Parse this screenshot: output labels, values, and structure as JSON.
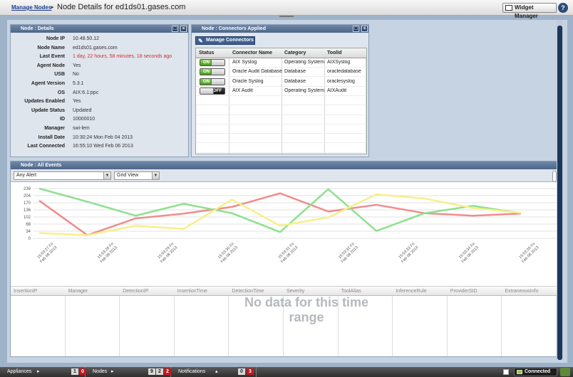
{
  "header": {
    "breadcrumb_link": "Manage Nodes",
    "title": "Node Details for ed1ds01.gases.com",
    "widget_manager_label": "Widget Manager",
    "help_label": "?"
  },
  "details_panel": {
    "title": "Node : Details",
    "rows": [
      {
        "label": "Node IP",
        "value": "10.48.50.12"
      },
      {
        "label": "Node Name",
        "value": "ed1ds01.gases.com"
      },
      {
        "label": "Last Event",
        "value": "1 day, 22 hours, 58 minutes, 18 seconds ago",
        "highlight": true
      },
      {
        "label": "Agent Node",
        "value": "Yes"
      },
      {
        "label": "USB",
        "value": "No"
      },
      {
        "label": "Agent Version",
        "value": "5.3.1"
      },
      {
        "label": "OS",
        "value": "AIX:6.1:ppc"
      },
      {
        "label": "Updates Enabled",
        "value": "Yes"
      },
      {
        "label": "Update Status",
        "value": "Updated"
      },
      {
        "label": "ID",
        "value": "10000010"
      },
      {
        "label": "Manager",
        "value": "swi-lem"
      },
      {
        "label": "Install Date",
        "value": "10:30:24 Mon Feb 04 2013"
      },
      {
        "label": "Last Connected",
        "value": "16:55:10 Wed Feb 06 2013"
      }
    ]
  },
  "connectors_panel": {
    "title": "Node : Connectors Applied",
    "manage_button": "Manage Connectors",
    "columns": [
      "Status",
      "Connector Name",
      "Category",
      "ToolId"
    ],
    "rows": [
      {
        "status": "ON",
        "name": "AIX Syslog",
        "category": "Operating System",
        "toolid": "AIXSyslog"
      },
      {
        "status": "ON",
        "name": "Oracle Audit Database",
        "category": "Database",
        "toolid": "oracledatabase"
      },
      {
        "status": "ON",
        "name": "Oracle Syslog",
        "category": "Database",
        "toolid": "oraclesyslog"
      },
      {
        "status": "OFF",
        "name": "AIX Audit",
        "category": "Operating System",
        "toolid": "AIXAudit"
      }
    ]
  },
  "events_panel": {
    "title": "Node : All Events",
    "filter_select": "Any Alert",
    "view_select": "Grid View",
    "no_data_message": "No data for this time range",
    "grid_columns": [
      "InsertionIP",
      "Manager",
      "DetectionIP",
      "InsertionTime",
      "DetectionTime",
      "Severity",
      "ToolAlias",
      "InferenceRule",
      "ProviderSID",
      "ExtraneousInfo"
    ]
  },
  "chart_data": {
    "type": "line",
    "yticks": [
      0,
      34,
      68,
      102,
      136,
      170,
      204,
      238
    ],
    "ylim": [
      0,
      238
    ],
    "categories": [
      "15:53:27 Fri Feb 08 2013",
      "15:53:28 Fri Feb 08 2013",
      "15:53:29 Fri Feb 08 2013",
      "15:53:30 Fri Feb 08 2013",
      "15:53:31 Fri Feb 08 2013",
      "15:53:32 Fri Feb 08 2013",
      "15:53:33 Fri Feb 08 2013",
      "15:53:34 Fri Feb 08 2013",
      "15:53:35 Fri Feb 08 2013"
    ],
    "series": [
      {
        "color": "#f08c8c",
        "x": [
          0,
          0.8,
          1.6,
          2.4,
          3.2,
          4.0,
          4.8,
          5.6,
          6.4,
          7.2,
          8.0
        ],
        "values": [
          180,
          15,
          95,
          118,
          150,
          215,
          128,
          160,
          120,
          108,
          118
        ]
      },
      {
        "color": "#8fe08f",
        "x": [
          0,
          0.8,
          1.6,
          2.4,
          3.2,
          4.0,
          4.8,
          5.6,
          6.4,
          7.2,
          8.0
        ],
        "values": [
          238,
          175,
          108,
          165,
          120,
          30,
          235,
          35,
          120,
          155,
          120
        ]
      },
      {
        "color": "#f5f08a",
        "x": [
          0,
          0.8,
          1.6,
          2.4,
          3.2,
          4.0,
          4.8,
          5.6,
          6.4,
          7.2,
          8.0
        ],
        "values": [
          25,
          15,
          60,
          45,
          185,
          60,
          100,
          210,
          190,
          145,
          122
        ]
      }
    ]
  },
  "statusbar": {
    "appliances_label": "Appliances",
    "appliances_counts": [
      "1",
      "0"
    ],
    "nodes_label": "Nodes",
    "nodes_counts": [
      "9",
      "2",
      "2"
    ],
    "notifications_label": "Notifications",
    "notifications_counts": [
      "0",
      "3"
    ],
    "connected_label": "Connected"
  },
  "colors": {
    "accent": "#3d5f8f",
    "alert_red": "#d22b2b",
    "toggle_on": "#4a9a1c"
  }
}
